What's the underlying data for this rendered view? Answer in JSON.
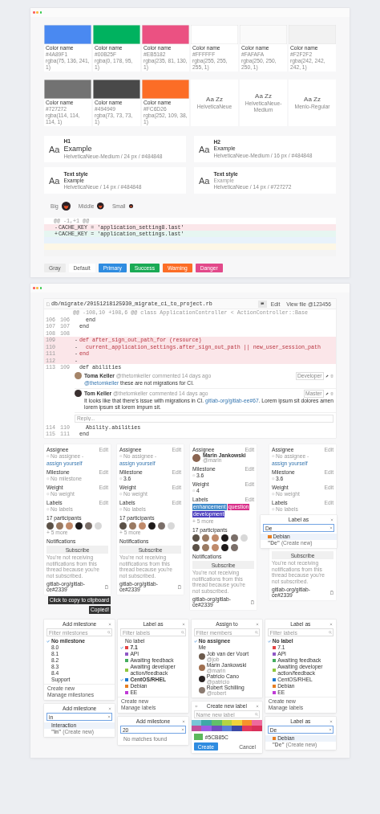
{
  "styleguide": {
    "swatches": [
      {
        "kind": "color",
        "color": "#4a89f1",
        "name": "Color name",
        "hex": "#4A89F1",
        "rgba": "rgba(75, 136, 241, 1)"
      },
      {
        "kind": "color",
        "color": "#00b25f",
        "name": "Color name",
        "hex": "#00B25F",
        "rgba": "rgba(0, 178, 95, 1)"
      },
      {
        "kind": "color",
        "color": "#eb5182",
        "name": "Color name",
        "hex": "#EB5182",
        "rgba": "rgba(235, 81, 130, 1)"
      },
      {
        "kind": "color",
        "color": "#ffffff",
        "name": "Color name",
        "hex": "#FFFFFF",
        "rgba": "rgba(255, 255, 255, 1)"
      },
      {
        "kind": "color",
        "color": "#fafafa",
        "name": "Color name",
        "hex": "#FAFAFA",
        "rgba": "rgba(250, 250, 250, 1)"
      },
      {
        "kind": "color",
        "color": "#f2f2f2",
        "name": "Color name",
        "hex": "#F2F2F2",
        "rgba": "rgba(242, 242, 242, 1)"
      },
      {
        "kind": "color",
        "color": "#727272",
        "name": "Color name",
        "hex": "#727272",
        "rgba": "rgba(114, 114, 114, 1)"
      },
      {
        "kind": "color",
        "color": "#494949",
        "name": "Color name",
        "hex": "#494949",
        "rgba": "rgba(73, 73, 73, 1)"
      },
      {
        "kind": "color",
        "color": "#fc6d26",
        "name": "Color name",
        "hex": "#FC6D26",
        "rgba": "rgba(252, 109, 38, 1)"
      },
      {
        "kind": "font",
        "sample": "Aa Zz",
        "font": "HelveticaNeue"
      },
      {
        "kind": "font",
        "sample": "Aa Zz",
        "font": "HelveticaNeue-Medium"
      },
      {
        "kind": "font",
        "sample": "Aa  Zz",
        "font": "Menlo-Regular"
      }
    ],
    "text_styles": [
      {
        "kind": "h1",
        "sample": "Aa",
        "tag": "H1",
        "example": "Example",
        "spec": "HelveticaNeue-Medium / 24 px / #484848"
      },
      {
        "kind": "h2",
        "sample": "Aa",
        "tag": "H2",
        "example": "Example",
        "spec": "HelveticaNeue-Medium / 16 px / #484848"
      },
      {
        "kind": "text",
        "sample": "Aa",
        "tag": "Text style",
        "example": "Example",
        "spec": "HelveticaNeue / 14 px / #484848"
      },
      {
        "kind": "muted",
        "sample": "Aa",
        "tag": "Text style",
        "example": "Example",
        "spec": "HelveticaNeue / 14 px / #727272"
      }
    ],
    "avatars": [
      {
        "kind": "big",
        "label": "Big"
      },
      {
        "kind": "middle",
        "label": "Middle"
      },
      {
        "kind": "small",
        "label": "Small"
      }
    ],
    "diff": {
      "hunk": "@@ -1,+1 @@",
      "lines": [
        {
          "kind": "removed",
          "sign": "-",
          "code": "CACHE_KEY = 'application_setting8.last'"
        },
        {
          "kind": "added",
          "sign": "+",
          "code": "CACHE_KEY = 'application_settings.last'"
        },
        {
          "kind": "info"
        },
        {
          "kind": "warning"
        },
        {
          "kind": "context"
        }
      ]
    },
    "buttons": [
      {
        "kind": "gray",
        "label": "Gray"
      },
      {
        "kind": "default",
        "label": "Default"
      },
      {
        "kind": "primary",
        "label": "Primary"
      },
      {
        "kind": "success",
        "label": "Success"
      },
      {
        "kind": "warning",
        "label": "Warning"
      },
      {
        "kind": "danger",
        "label": "Danger"
      }
    ]
  },
  "review": {
    "path": "db/migrate/20151218125930_migrate_ci_to_project.rb",
    "actions": [
      {
        "kind": "icon"
      },
      {
        "kind": "text",
        "label": "Edit"
      },
      {
        "kind": "text",
        "label": "View file @123456"
      }
    ],
    "hunk": "@@ -108,10 +108,6 @@ class ApplicationController < ActionController::Base",
    "lines": [
      {
        "kind": "context",
        "old": "106",
        "new": "106",
        "code": "  end"
      },
      {
        "kind": "context",
        "old": "107",
        "new": "107",
        "code": "end"
      },
      {
        "kind": "context",
        "old": "108",
        "new": "108"
      },
      {
        "kind": "removed",
        "old": "109",
        "sign": "-",
        "code": "def after_sign_out_path_for (resource)"
      },
      {
        "kind": "removed",
        "old": "110",
        "sign": "-",
        "code": "  current_application_settings.after_sign_out_path || new_user_session_path"
      },
      {
        "kind": "removed",
        "old": "111",
        "sign": "-",
        "code": "end"
      },
      {
        "kind": "removed",
        "old": "112",
        "sign": "-"
      },
      {
        "kind": "context",
        "old": "113",
        "new": "109",
        "code": "def abilities"
      },
      {
        "kind": "discussion",
        "reply_placeholder": "Reply...",
        "comments": [
          {
            "author": "Toma Keller",
            "handle": "@thetomkeller",
            "meta": "commented 14 days ago",
            "role": "Developer",
            "body": [
              {
                "kind": "link",
                "text": "@thetomkeller"
              },
              {
                "kind": "text",
                "text": " these are not migrations for CI."
              }
            ]
          },
          {
            "author": "Tom Keller",
            "handle": "@thetomkeller",
            "meta": "commented 14 days ago",
            "role": "Master",
            "body": [
              {
                "kind": "text",
                "text": "It looks like that there's issue with migrations in CI. "
              },
              {
                "kind": "link",
                "text": "gitlab-org/gitlab-ee#67"
              },
              {
                "kind": "text",
                "text": ". Lorem ipsum sit dolores amen lorem ipsum sit  lorem impum sit."
              }
            ]
          }
        ]
      },
      {
        "kind": "context",
        "old": "114",
        "new": "110",
        "code": "  Ability.abilities"
      },
      {
        "kind": "context",
        "old": "115",
        "new": "111",
        "code": "end"
      }
    ]
  },
  "sidebars": [
    {
      "sections": [
        {
          "kind": "none",
          "title": "Assignee",
          "action": "Edit",
          "value": "No assignee -",
          "link": "assign yourself"
        },
        {
          "kind": "none",
          "title": "Milestone",
          "action": "Edit",
          "value": "No milestone"
        },
        {
          "kind": "none",
          "title": "Weight",
          "action": "Edit",
          "value": "No weight"
        },
        {
          "kind": "none",
          "title": "Labels",
          "action": "Edit",
          "value": "No labels"
        },
        {
          "kind": "participants",
          "title": "17 participants",
          "more": "+ 5 more",
          "avatars": [
            {
              "color": "#5b5147"
            },
            {
              "color": "#9a7a62"
            },
            {
              "color": "#c08a6a"
            },
            {
              "color": "#1e1a1a"
            },
            {
              "color": "#7a6e68"
            },
            {
              "color": "#d8d8d8"
            }
          ]
        },
        {
          "kind": "notifications",
          "title": "Notifications",
          "button": "Subscribe",
          "note": "You're not receiving notifications from this thread because you're not subscribed."
        },
        {
          "kind": "reference",
          "text": "gitlab-org/gitlab-ce#2339"
        }
      ],
      "tooltips": [
        "Click to copy to clipboard",
        "Copied!"
      ]
    },
    {
      "sections": [
        {
          "kind": "none",
          "title": "Assignee",
          "action": "Edit",
          "value": "No assignee -",
          "link": "assign yourself"
        },
        {
          "kind": "value",
          "title": "Milestone",
          "action": "Edit",
          "value": "3.6"
        },
        {
          "kind": "none",
          "title": "Weight",
          "action": "Edit",
          "value": "No weight"
        },
        {
          "kind": "none",
          "title": "Labels",
          "action": "Edit",
          "value": "No labels"
        },
        {
          "kind": "participants",
          "title": "17 participants",
          "more": "+ 5 more",
          "avatars": [
            {
              "color": "#5b5147"
            },
            {
              "color": "#9a7a62"
            },
            {
              "color": "#c08a6a"
            },
            {
              "color": "#1e1a1a"
            },
            {
              "color": "#7a6e68"
            },
            {
              "color": "#d8d8d8"
            }
          ]
        },
        {
          "kind": "notifications",
          "title": "Notifications",
          "button": "Subscribe",
          "note": "You're not receiving notifications from this thread because you're not subscribed."
        },
        {
          "kind": "reference",
          "text": "gitlab-org/gitlab-ce#2339"
        }
      ]
    },
    {
      "sections": [
        {
          "kind": "user",
          "title": "Assignee",
          "action": "Edit",
          "name": "Marin Jankowski",
          "handle": "@marin"
        },
        {
          "kind": "value",
          "title": "Milestone",
          "action": "Edit",
          "value": "3.6"
        },
        {
          "kind": "value",
          "title": "Weight",
          "action": "Edit",
          "value": "4"
        },
        {
          "kind": "labels",
          "title": "Labels",
          "action": "Edit",
          "more": "+ 5 more",
          "labels": [
            {
              "text": "enhancement",
              "color": "#428bca"
            },
            {
              "text": "question",
              "color": "#d9308a"
            },
            {
              "text": "development",
              "color": "#4b3fbf"
            }
          ]
        },
        {
          "kind": "participants",
          "title": "17 participants",
          "avatars": [
            {
              "color": "#5b5147"
            },
            {
              "color": "#9a7a62"
            },
            {
              "color": "#c08a6a"
            },
            {
              "color": "#1e1a1a"
            },
            {
              "color": "#7a6e68"
            },
            {
              "color": "#d8d8d8"
            },
            {
              "color": "#5b5147"
            },
            {
              "color": "#9a7a62"
            },
            {
              "color": "#c08a6a"
            },
            {
              "color": "#1e1a1a"
            },
            {
              "color": "#7a6e68"
            }
          ]
        },
        {
          "kind": "notifications",
          "title": "Notifications",
          "button": "Subscribe",
          "note": "You're not receiving notifications from this thread because you're not subscribed."
        },
        {
          "kind": "reference",
          "text": "gitlab-org/gitlab-ce#2339"
        }
      ]
    },
    {
      "sections": [
        {
          "kind": "none",
          "title": "Assignee",
          "action": "Edit",
          "value": "No assignee -",
          "link": "assign yourself"
        },
        {
          "kind": "value",
          "title": "Milestone",
          "action": "Edit",
          "value": "3.6"
        },
        {
          "kind": "none",
          "title": "Weight",
          "action": "Edit",
          "value": "No weight"
        },
        {
          "kind": "none",
          "title": "Labels",
          "action": "Edit",
          "value": "No labels"
        },
        {
          "kind": "popup",
          "menu": {
            "title": "Label as",
            "back": false,
            "search": {
              "value": "De"
            },
            "items": [
              {
                "kind": "label",
                "label": "Debian",
                "color": "#e67e22",
                "selected": true
              },
              {
                "kind": "create",
                "text": "**\"De\"** (Create new)",
                "selected": false
              }
            ]
          }
        },
        {
          "kind": "notifications",
          "button": "Subscribe",
          "note": "You're not receiving notifications from this thread because you're not subscribed."
        },
        {
          "kind": "reference",
          "text": "gitlab-org/gitlab-ce#2339"
        }
      ]
    }
  ],
  "dropdown_columns": [
    {
      "menus": [
        {
          "title": "Add milestone",
          "back": false,
          "search": {
            "placeholder": "Filter milestones"
          },
          "items": [
            {
              "kind": "option",
              "label": "No milestone",
              "checked": true
            },
            {
              "kind": "option",
              "label": "8.0",
              "checked": false
            },
            {
              "kind": "option",
              "label": "8.1",
              "checked": false
            },
            {
              "kind": "option",
              "label": "8.2",
              "checked": false
            },
            {
              "kind": "option",
              "label": "8.3",
              "checked": false
            },
            {
              "kind": "option",
              "label": "8.4",
              "checked": false
            },
            {
              "kind": "option",
              "label": "Support",
              "checked": false
            }
          ],
          "footer": [
            "Create new",
            "Manage milestones"
          ]
        },
        {
          "title": "Add milestone",
          "back": false,
          "search": {
            "value": "in"
          },
          "items": [
            {
              "kind": "option",
              "label": "Interaction",
              "selected": true
            },
            {
              "kind": "create",
              "text": "**\"In\"** (Create new)",
              "selected": false
            }
          ]
        }
      ]
    },
    {
      "menus": [
        {
          "title": "Label as",
          "back": false,
          "search": {
            "placeholder": "Filter labels"
          },
          "items": [
            {
              "kind": "option",
              "label": "No label",
              "checked": false
            },
            {
              "kind": "label",
              "label": "7.1",
              "color": "#e24343",
              "checked": true
            },
            {
              "kind": "label",
              "label": "API",
              "color": "#8e58c6",
              "checked": false
            },
            {
              "kind": "label",
              "label": "Awaiting feedback",
              "color": "#44ad5e",
              "checked": false
            },
            {
              "kind": "label",
              "label": "Awaiting developer action/feedback",
              "color": "#8fc73d",
              "checked": false
            },
            {
              "kind": "label",
              "label": "CentOS/RHEL",
              "color": "#1f78d1",
              "checked": true
            },
            {
              "kind": "label",
              "label": "Debian",
              "color": "#e67e22",
              "checked": false
            },
            {
              "kind": "label",
              "label": "EE",
              "color": "#c03ad6",
              "checked": false
            }
          ],
          "footer": [
            "Create new",
            "Manage labels"
          ]
        },
        {
          "title": "Add milestone",
          "back": false,
          "search": {
            "value": "20"
          },
          "items": [
            {
              "kind": "note",
              "label": "No matches found"
            }
          ]
        }
      ]
    },
    {
      "menus": [
        {
          "title": "Assign to",
          "back": false,
          "search": {
            "placeholder": "Filter members"
          },
          "items": [
            {
              "kind": "option",
              "label": "No assignee",
              "checked": true
            },
            {
              "kind": "option",
              "label": "Me",
              "checked": false
            },
            {
              "kind": "user",
              "name": "Job van der Voort",
              "handle": "@job",
              "color": "#6b5a4c",
              "checked": false
            },
            {
              "kind": "user",
              "name": "Marin Jankowski",
              "handle": "@marin",
              "color": "#a07050",
              "checked": false
            },
            {
              "kind": "user",
              "name": "Patricio Cano",
              "handle": "@patricio",
              "color": "#2a2424",
              "checked": false
            },
            {
              "kind": "user",
              "name": "Robert Schilling",
              "handle": "@robert",
              "color": "#8a7a70",
              "checked": false
            }
          ]
        },
        {
          "title": "Create new label",
          "back": true,
          "search": {
            "placeholder": "Name new label"
          },
          "palette": [
            {
              "color": "#78c6d7"
            },
            {
              "color": "#3ea8a7"
            },
            {
              "color": "#61c06a"
            },
            {
              "color": "#b5d443"
            },
            {
              "color": "#f0d43b"
            },
            {
              "color": "#f7932b"
            },
            {
              "color": "#ee6a9d"
            },
            {
              "color": "#c14f9b"
            },
            {
              "color": "#9b5de5"
            },
            {
              "color": "#6f4fbf"
            },
            {
              "color": "#5b7fd7"
            },
            {
              "color": "#3c4aa6"
            },
            {
              "color": "#e3395c"
            },
            {
              "color": "#d9305a"
            }
          ],
          "chosen": {
            "color": "#5cb85c",
            "text": "#5CB85C"
          },
          "buttons": [
            {
              "kind": "primary",
              "label": "Create"
            },
            {
              "kind": "default",
              "label": "Cancel"
            }
          ]
        }
      ]
    },
    {
      "menus": [
        {
          "title": "Label as",
          "back": false,
          "search": {
            "placeholder": "Filter labels"
          },
          "items": [
            {
              "kind": "option",
              "label": "No label",
              "checked": true
            },
            {
              "kind": "label",
              "label": "7.1",
              "color": "#e24343",
              "checked": false
            },
            {
              "kind": "label",
              "label": "API",
              "color": "#8e58c6",
              "checked": false
            },
            {
              "kind": "label",
              "label": "Awaiting feedback",
              "color": "#44ad5e",
              "checked": false
            },
            {
              "kind": "label",
              "label": "Awaiting developer action/feedback",
              "color": "#8fc73d",
              "checked": false
            },
            {
              "kind": "label",
              "label": "CentOS/RHEL",
              "color": "#1f78d1",
              "checked": false
            },
            {
              "kind": "label",
              "label": "Debian",
              "color": "#e67e22",
              "checked": false
            },
            {
              "kind": "label",
              "label": "EE",
              "color": "#c03ad6",
              "checked": false
            }
          ],
          "footer": [
            "Create new",
            "Manage labels"
          ]
        },
        {
          "title": "Label as",
          "back": false,
          "search": {
            "value": "De"
          },
          "items": [
            {
              "kind": "label",
              "label": "Debian",
              "color": "#e67e22",
              "selected": true
            },
            {
              "kind": "create",
              "text": "**\"De\"** (Create new)",
              "selected": false
            }
          ]
        }
      ]
    }
  ]
}
